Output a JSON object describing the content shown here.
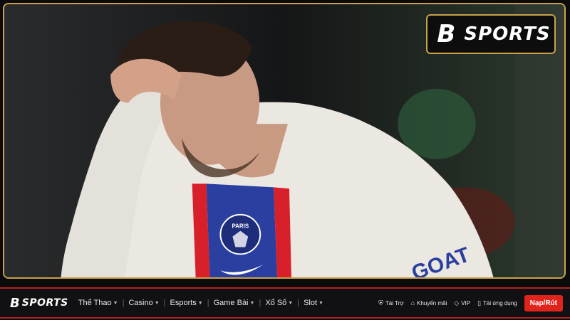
{
  "brand": {
    "logo_mark": "B",
    "logo_text": "SPORTS",
    "accent_gold": "#c9a24a",
    "accent_red": "#e0241b"
  },
  "photo": {
    "jersey_badge_text": "PARIS",
    "sleeve_text": "GOAT"
  },
  "nav": {
    "logo_mark": "B",
    "logo_text": "SPORTS",
    "menu": [
      {
        "label": "Thể Thao"
      },
      {
        "label": "Casino"
      },
      {
        "label": "Esports"
      },
      {
        "label": "Game Bài"
      },
      {
        "label": "Xổ Số"
      },
      {
        "label": "Slot"
      }
    ],
    "utilities": [
      {
        "label": "Tài Trợ",
        "icon": "shield-icon"
      },
      {
        "label": "Khuyến mãi",
        "icon": "tag-icon"
      },
      {
        "label": "VIP",
        "icon": "diamond-icon"
      },
      {
        "label": "Tải ứng dụng",
        "icon": "phone-icon"
      }
    ],
    "deposit_label": "Nạp/Rút"
  }
}
